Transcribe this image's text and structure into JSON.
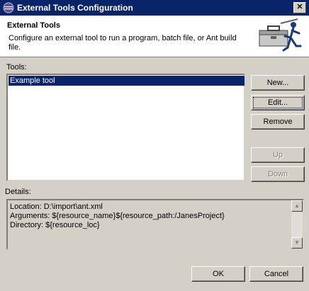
{
  "window": {
    "title": "External Tools Configuration",
    "close_glyph": "✕"
  },
  "header": {
    "title": "External Tools",
    "description": "Configure an external tool to run a program, batch file, or Ant build file.",
    "icon": "toolbox-runner-icon"
  },
  "tools": {
    "label": "Tools:",
    "items": [
      "Example tool"
    ],
    "selected": "Example tool"
  },
  "buttons": {
    "new": "New...",
    "edit": "Edit...",
    "remove": "Remove",
    "up": "Up",
    "down": "Down",
    "ok": "OK",
    "cancel": "Cancel"
  },
  "details": {
    "label": "Details:",
    "lines": [
      "Location: D:\\import\\ant.xml",
      "Arguments: ${resource_name}${resource_path:/JanesProject}",
      "Directory: ${resource_loc}"
    ]
  },
  "colors": {
    "title_bar": "#0a246a",
    "face": "#d4d0c8",
    "selection": "#0a246a"
  }
}
